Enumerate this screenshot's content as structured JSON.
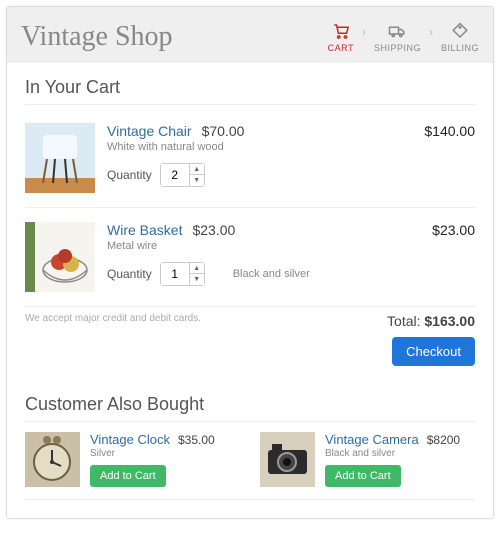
{
  "header": {
    "logo": "Vintage Shop",
    "steps": {
      "cart": "CART",
      "shipping": "SHIPPING",
      "billing": "BILLING"
    }
  },
  "cart": {
    "title": "In Your Cart",
    "quantity_label": "Quantity",
    "items": [
      {
        "name": "Vintage Chair",
        "price": "$70.00",
        "desc": "White with natural wood",
        "qty": "2",
        "variant": "",
        "line_total": "$140.00"
      },
      {
        "name": "Wire Basket",
        "price": "$23.00",
        "desc": "Metal wire",
        "qty": "1",
        "variant": "Black and silver",
        "line_total": "$23.00"
      }
    ],
    "accept_note": "We accept major credit and debit cards.",
    "total_label": "Total:",
    "total_value": "$163.00",
    "checkout_label": "Checkout"
  },
  "also": {
    "title": "Customer Also Bought",
    "add_label": "Add to Cart",
    "items": [
      {
        "name": "Vintage Clock",
        "price": "$35.00",
        "desc": "Silver"
      },
      {
        "name": "Vintage Camera",
        "price": "$8200",
        "desc": "Black and silver"
      }
    ]
  }
}
